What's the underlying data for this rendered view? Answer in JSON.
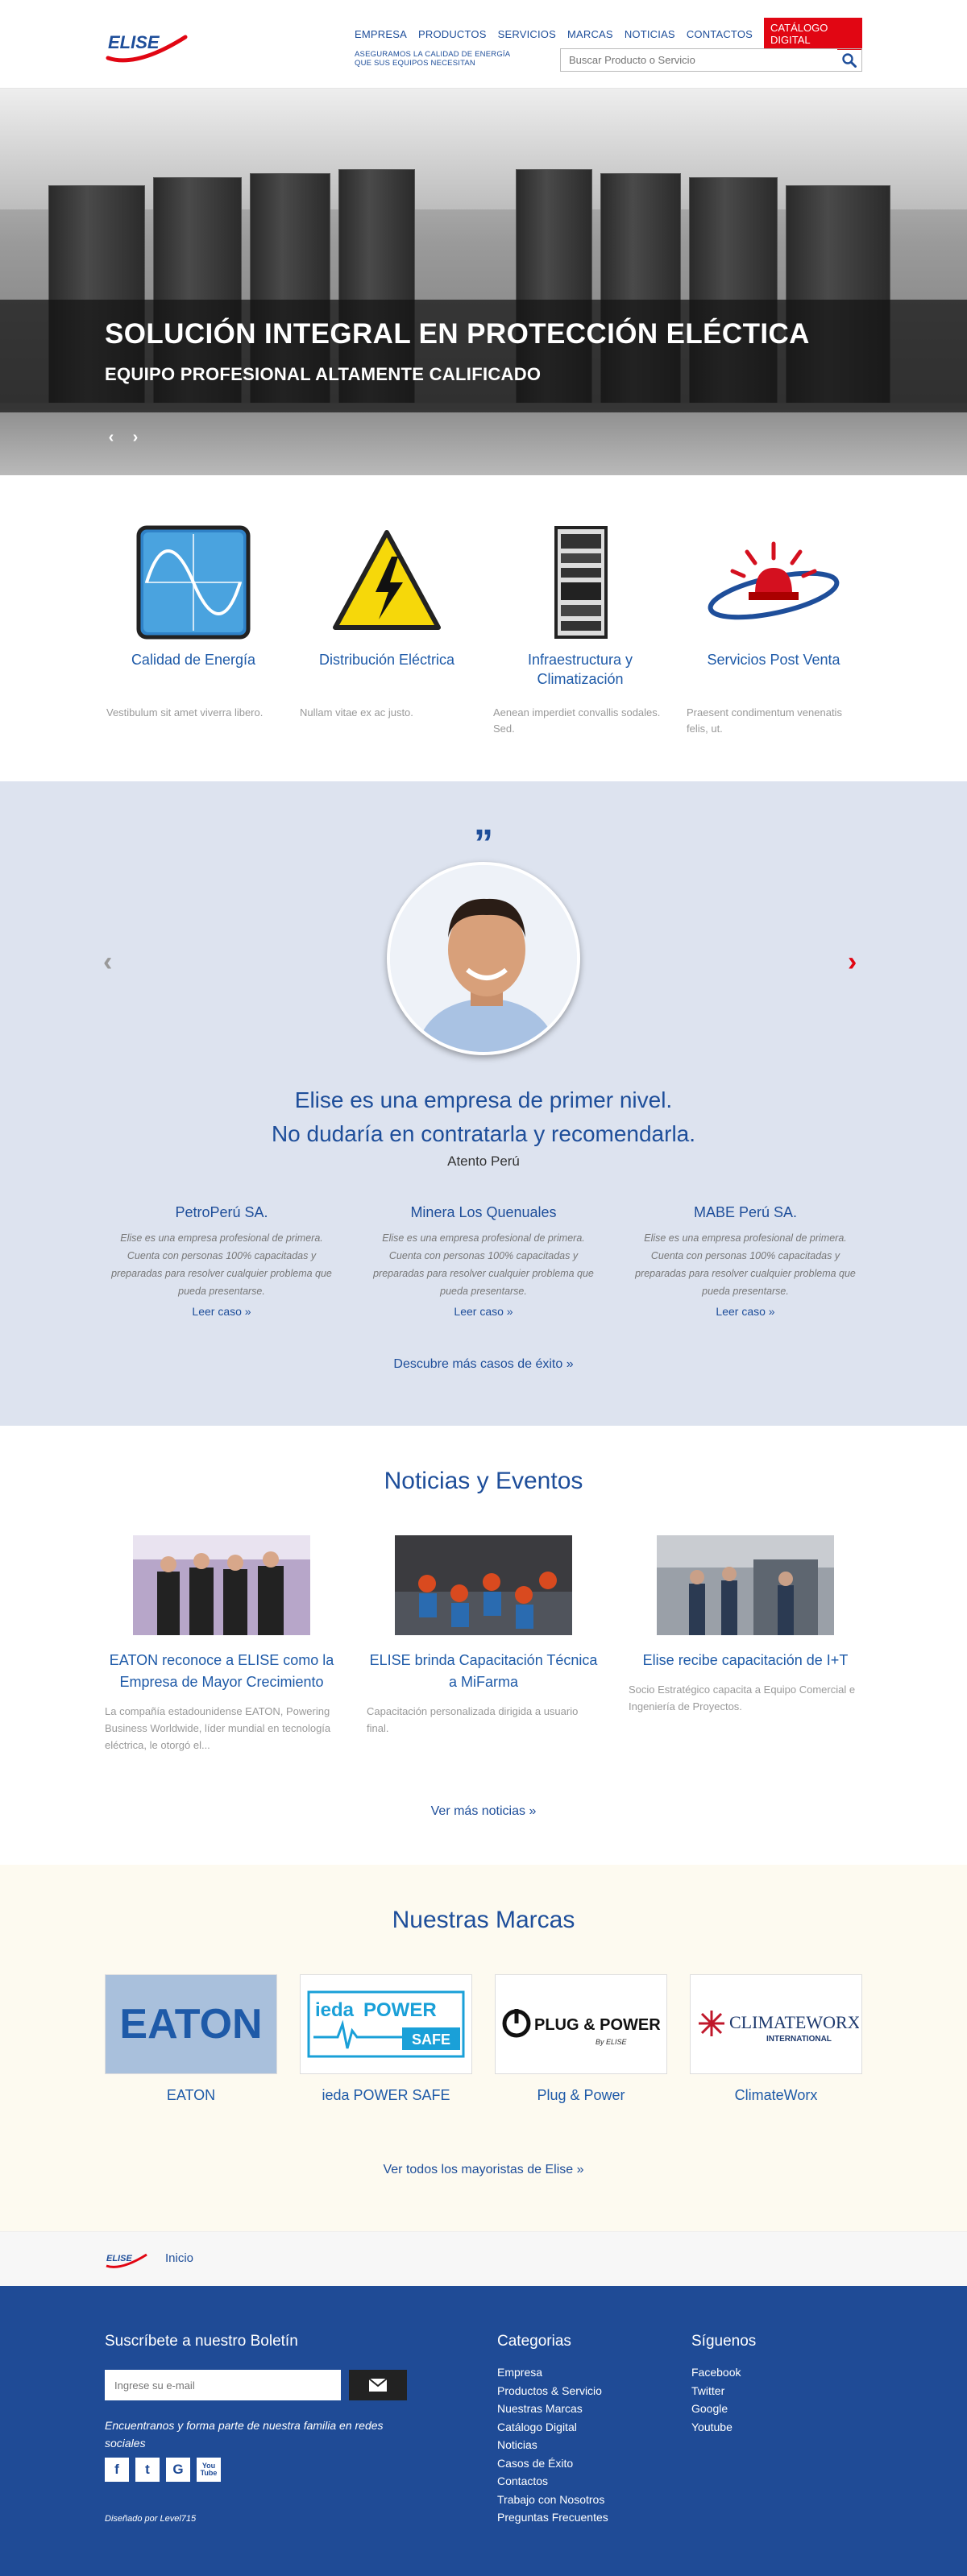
{
  "header": {
    "logo_text": "ELISE",
    "nav": [
      "EMPRESA",
      "PRODUCTOS",
      "SERVICIOS",
      "MARCAS",
      "NOTICIAS",
      "CONTACTOS"
    ],
    "catalog": "CATÁLOGO DIGITAL",
    "tagline": "ASEGURAMOS LA CALIDAD DE ENERGÍA QUE SUS EQUIPOS NECESITAN",
    "search_placeholder": "Buscar Producto o Servicio"
  },
  "hero": {
    "title": "SOLUCIÓN INTEGRAL EN PROTECCIÓN ELÉCTICA",
    "subtitle": "EQUIPO PROFESIONAL ALTAMENTE CALIFICADO",
    "prev": "‹",
    "next": "›"
  },
  "services": [
    {
      "title": "Calidad de Energía",
      "text": "Vestibulum sit amet viverra libero.",
      "icon": "sine-wave-icon"
    },
    {
      "title": "Distribución Eléctrica",
      "text": "Nullam vitae ex ac justo.",
      "icon": "high-voltage-icon"
    },
    {
      "title": "Infraestructura y Climatización",
      "text": "Aenean imperdiet convallis sodales. Sed.",
      "icon": "server-rack-icon"
    },
    {
      "title": "Servicios Post Venta",
      "text": "Praesent condimentum venenatis felis, ut.",
      "icon": "alarm-light-icon"
    }
  ],
  "testimonial": {
    "quote_line1": "Elise es una empresa de primer nivel.",
    "quote_line2": "No dudaría en contratarla y recomendarla.",
    "author": "Atento Perú",
    "cases": [
      {
        "company": "PetroPerú SA.",
        "text": "Elise es una empresa profesional de primera. Cuenta con personas 100% capacitadas y preparadas para resolver cualquier problema que pueda presentarse.",
        "link": "Leer caso »"
      },
      {
        "company": "Minera Los Quenuales",
        "text": "Elise es una empresa profesional de primera. Cuenta con personas 100% capacitadas y preparadas para resolver cualquier problema que pueda presentarse.",
        "link": "Leer caso »"
      },
      {
        "company": "MABE Perú SA.",
        "text": "Elise es una empresa profesional de primera. Cuenta con personas 100% capacitadas y preparadas para resolver cualquier problema que pueda presentarse.",
        "link": "Leer caso »"
      }
    ],
    "more": "Descubre más casos de éxito »"
  },
  "news": {
    "title": "Noticias y Eventos",
    "items": [
      {
        "title": "EATON reconoce a ELISE como la Empresa de Mayor Crecimiento",
        "text": "La compañía estadounidense EATON, Powering Business Worldwide, líder mundial en tecnología eléctrica, le otorgó el..."
      },
      {
        "title": "ELISE brinda Capacitación Técnica a MiFarma",
        "text": "Capacitación personalizada dirigida a usuario final."
      },
      {
        "title": "Elise recibe capacitación de I+T",
        "text": "Socio Estratégico capacita a Equipo Comercial e Ingeniería de Proyectos."
      }
    ],
    "more": "Ver más noticias »"
  },
  "brands": {
    "title": "Nuestras Marcas",
    "items": [
      {
        "name": "EATON",
        "logo_text": "EATON"
      },
      {
        "name": "ieda POWER SAFE",
        "logo_text_1": "ieda",
        "logo_text_2": "POWER",
        "logo_text_3": "SAFE"
      },
      {
        "name": "Plug & Power",
        "logo_text": "PLUG & POWER",
        "logo_sub": "By ELISE"
      },
      {
        "name": "ClimateWorx",
        "logo_text": "CLIMATEWORX",
        "logo_sub": "INTERNATIONAL"
      }
    ],
    "more": "Ver todos los mayoristas de Elise »"
  },
  "breadcrumb": {
    "home": "Inicio"
  },
  "footer": {
    "newsletter_title": "Suscríbete a nuestro Boletín",
    "email_placeholder": "Ingrese su e-mail",
    "join_text": "Encuentranos y forma parte de nuestra familia en redes sociales",
    "social_glyphs": [
      "f",
      "t",
      "G",
      "You Tube"
    ],
    "designed": "Diseñado por Level715",
    "categories_title": "Categorias",
    "categories": [
      "Empresa",
      "Productos & Servicio",
      "Nuestras Marcas",
      "Catálogo Digital",
      "Noticias",
      "Casos de Éxito",
      "Contactos",
      "Trabajo con Nosotros",
      "Preguntas Frecuentes"
    ],
    "follow_title": "Síguenos",
    "follow": [
      "Facebook",
      "Twitter",
      "Google",
      "Youtube"
    ]
  },
  "colors": {
    "brand_blue": "#1e4e9a",
    "accent_red": "#e10613",
    "footer_blue": "#1f4b96",
    "testimonial_bg": "#dde3ef",
    "brands_bg": "#fdfaf0"
  }
}
